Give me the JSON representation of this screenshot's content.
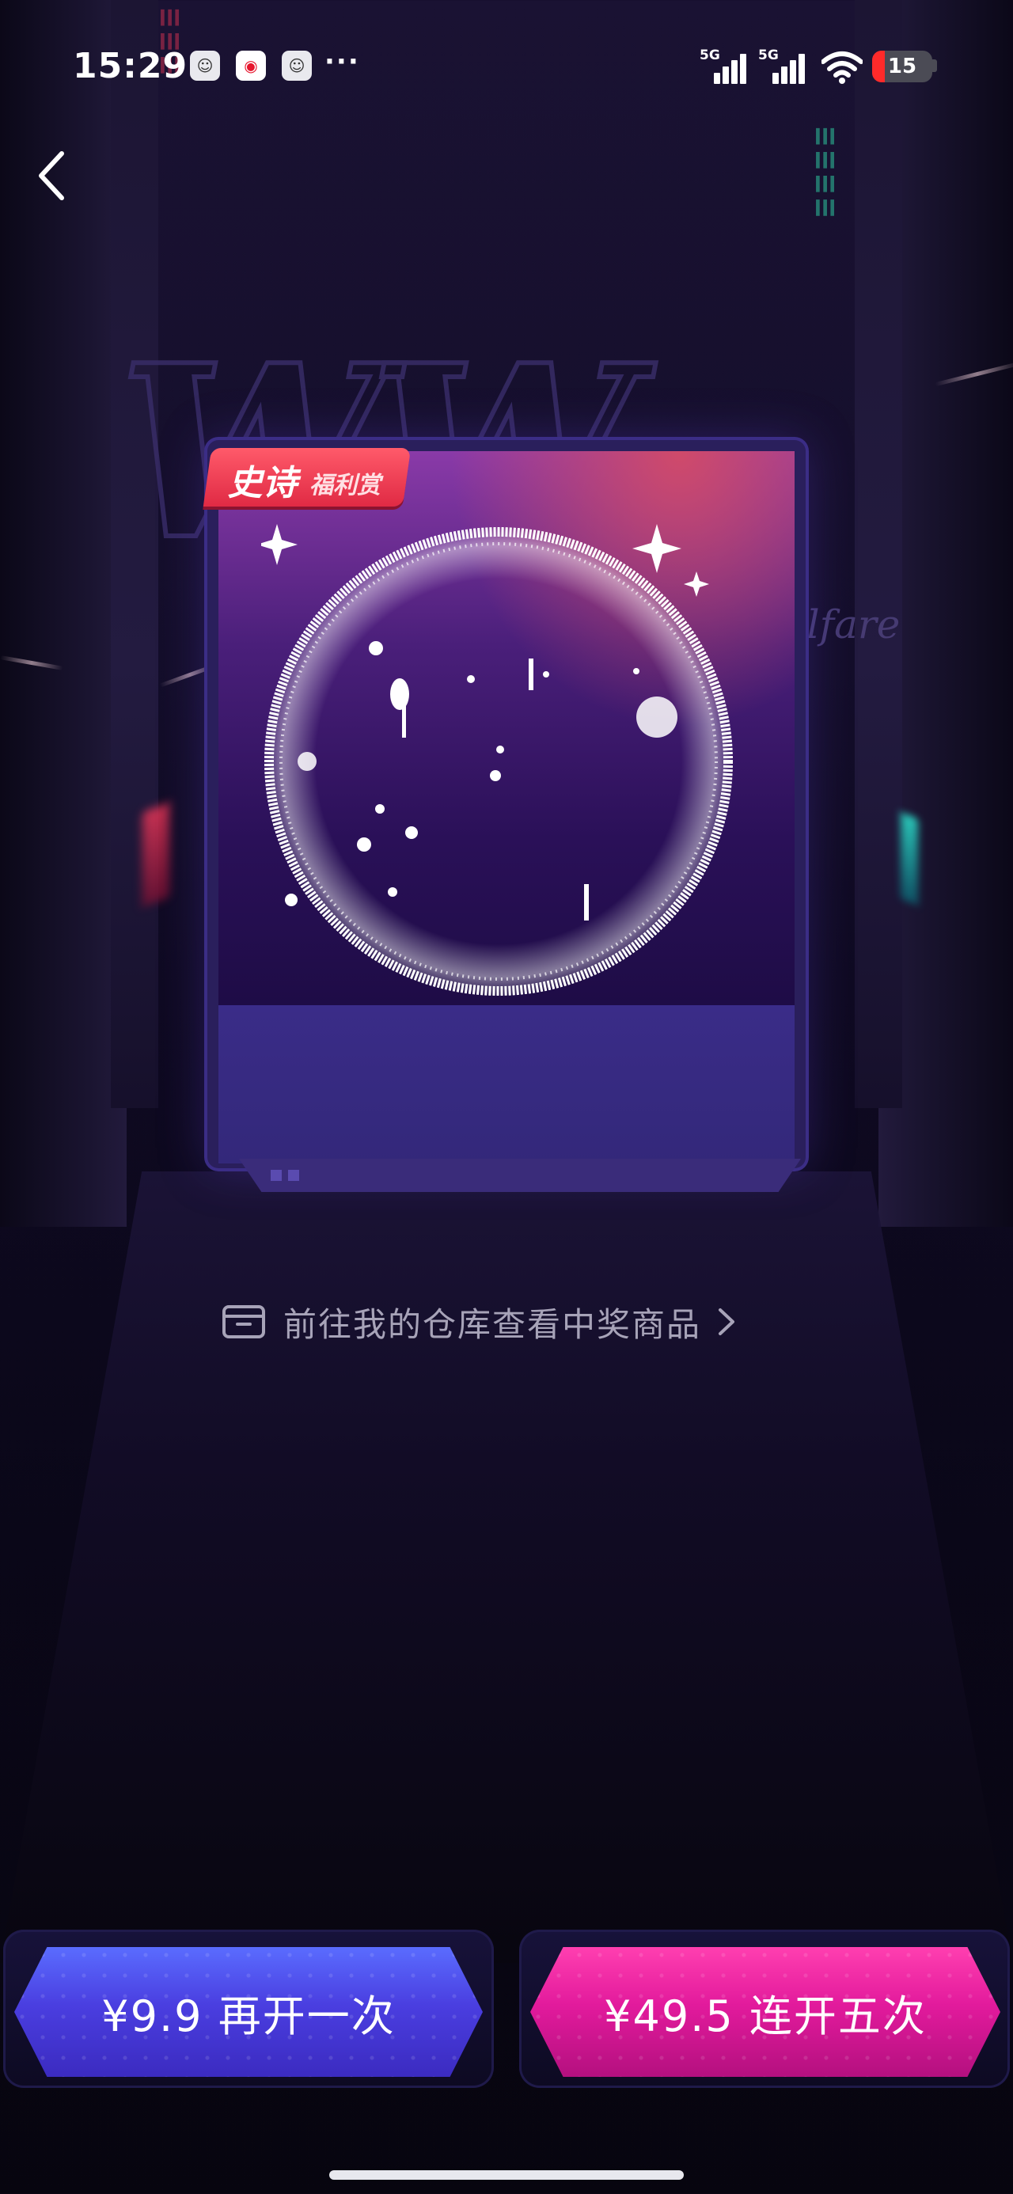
{
  "status_bar": {
    "time": "15:29",
    "notification_icons": [
      "app-icon",
      "weibo-icon",
      "app-icon"
    ],
    "more": "···",
    "signal_1_label": "5G",
    "signal_2_label": "5G",
    "battery_level": "15"
  },
  "background": {
    "welfare_text": "elfare"
  },
  "card": {
    "rarity_main": "史诗",
    "rarity_sub": "福利赏"
  },
  "warehouse_link": {
    "label": "前往我的仓库查看中奖商品"
  },
  "buttons": {
    "open_once": "¥9.9 再开一次",
    "open_five": "¥49.5 连开五次"
  },
  "colors": {
    "button_once": "#4a3ee0",
    "button_five": "#e21a9c",
    "rarity_badge": "#e02a44",
    "battery_low": "#ff2a2a"
  }
}
